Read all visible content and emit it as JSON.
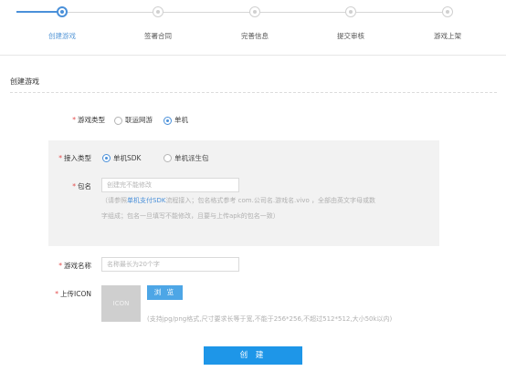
{
  "stepper": {
    "steps": [
      {
        "label": "创建游戏",
        "state": "active"
      },
      {
        "label": "签署合同",
        "state": "pending"
      },
      {
        "label": "完善信息",
        "state": "pending"
      },
      {
        "label": "提交审核",
        "state": "pending"
      },
      {
        "label": "游戏上架",
        "state": "pending"
      }
    ]
  },
  "section": {
    "title": "创建游戏"
  },
  "form": {
    "required_mark": "*",
    "game_type": {
      "label": "游戏类型",
      "options": [
        {
          "label": "联运网游",
          "checked": false
        },
        {
          "label": "单机",
          "checked": true
        }
      ]
    },
    "access_type": {
      "label": "接入类型",
      "options": [
        {
          "label": "单机SDK",
          "checked": true
        },
        {
          "label": "单机派生包",
          "checked": false
        }
      ]
    },
    "package_name": {
      "label": "包名",
      "placeholder": "创建完不能修改",
      "hint_prefix": "（请参照",
      "hint_link": "单机支付SDK",
      "hint_rest": "流程接入；包名格式参考 com.公司名.游戏名.vivo ，全部由英文字母或数",
      "hint_line2": "字组成；包名一旦填写不能修改，且要与上传apk的包名一致）"
    },
    "game_name": {
      "label": "游戏名称",
      "placeholder": "名称最长为20个字"
    },
    "upload_icon": {
      "label": "上传ICON",
      "placeholder_text": "ICON",
      "browse_label": "浏 览",
      "hint": "(支持jpg/png格式,尺寸要求长等于宽,不能于256*256,不超过512*512,大小50k以内)"
    },
    "submit_label": "创 建"
  },
  "colors": {
    "accent": "#4a90d9",
    "button": "#1e96e8",
    "required": "#e34b4b"
  }
}
